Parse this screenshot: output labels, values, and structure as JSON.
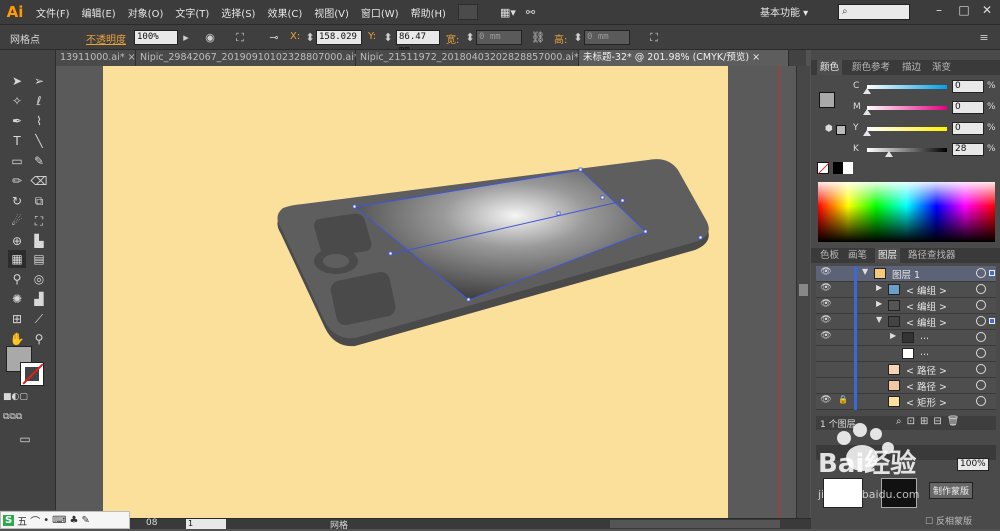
{
  "app": {
    "logo": "Ai"
  },
  "menu": [
    "文件(F)",
    "编辑(E)",
    "对象(O)",
    "文字(T)",
    "选择(S)",
    "效果(C)",
    "视图(V)",
    "窗口(W)",
    "帮助(H)"
  ],
  "workspace_label": "基本功能",
  "control_bar": {
    "selection_label": "网格点",
    "opacity_label": "不透明度",
    "opacity_value": "100%",
    "x_label": "X:",
    "x_value": "158.029",
    "y_label": "Y:",
    "y_value": "86.47 mm",
    "w_label": "宽:",
    "w_value": "0 mm",
    "h_label": "高:",
    "h_value": "0 mm"
  },
  "tabs": [
    {
      "label": "13911000.ai*"
    },
    {
      "label": "Nipic_29842067_20190910102328807000.ai*"
    },
    {
      "label": "Nipic_21511972_20180403202828857000.ai*"
    },
    {
      "label": "未标题-32* @ 201.98% (CMYK/预览)"
    }
  ],
  "color_panel": {
    "tabs": [
      "颜色",
      "颜色参考",
      "描边",
      "渐变"
    ],
    "sliders": [
      {
        "label": "C",
        "value": "0",
        "gradient": "linear-gradient(to right,#fff,#00a0e9)",
        "knob": 0
      },
      {
        "label": "M",
        "value": "0",
        "gradient": "linear-gradient(to right,#fff,#e4007f)",
        "knob": 0
      },
      {
        "label": "Y",
        "value": "0",
        "gradient": "linear-gradient(to right,#fff,#fff100)",
        "knob": 0
      },
      {
        "label": "K",
        "value": "28",
        "gradient": "linear-gradient(to right,#fff,#000)",
        "knob": 0.28
      }
    ],
    "pct": "%"
  },
  "layers_panel": {
    "tabs": [
      "色板",
      "画笔",
      "图层",
      "路径查找器"
    ],
    "rows": [
      {
        "name": "图层 1",
        "indent": 0,
        "arrow": "▼",
        "eye": true,
        "thumb": "#f6c87c",
        "selected": true
      },
      {
        "name": "< 编组 >",
        "indent": 1,
        "arrow": "▶",
        "eye": true,
        "thumb": "#6a9fc9",
        "selected": false
      },
      {
        "name": "< 编组 >",
        "indent": 1,
        "arrow": "▶",
        "eye": true,
        "thumb": "#555555",
        "selected": false
      },
      {
        "name": "< 编组 >",
        "indent": 1,
        "arrow": "▼",
        "eye": true,
        "thumb": "#444444",
        "selected": false
      },
      {
        "name": "...",
        "indent": 2,
        "arrow": "▶",
        "eye": true,
        "thumb": "#333333",
        "selected": false
      },
      {
        "name": "...",
        "indent": 2,
        "arrow": "",
        "eye": false,
        "thumb": "#ffffff",
        "selected": false
      },
      {
        "name": "< 路径 >",
        "indent": 1,
        "arrow": "",
        "eye": false,
        "thumb": "#f4d5b5",
        "selected": false
      },
      {
        "name": "< 路径 >",
        "indent": 1,
        "arrow": "",
        "eye": false,
        "thumb": "#f2c9a0",
        "selected": false
      },
      {
        "name": "< 矩形 >",
        "indent": 1,
        "arrow": "",
        "eye": true,
        "lock": true,
        "thumb": "#fbe09c",
        "selected": false
      }
    ],
    "footer": "1 个图层"
  },
  "transparency_panel": {
    "opacity": "100%",
    "make_mask": "制作蒙版",
    "invert_mask": "反相蒙版"
  },
  "status_bar": {
    "zoom": "08",
    "page": "1",
    "tool": "网格"
  },
  "ime_bar": [
    "五",
    "⌒",
    "•",
    "⌨",
    "♣",
    "✎"
  ],
  "watermark": {
    "text": "Bai经验",
    "url": "jingyan.baidu.com"
  }
}
